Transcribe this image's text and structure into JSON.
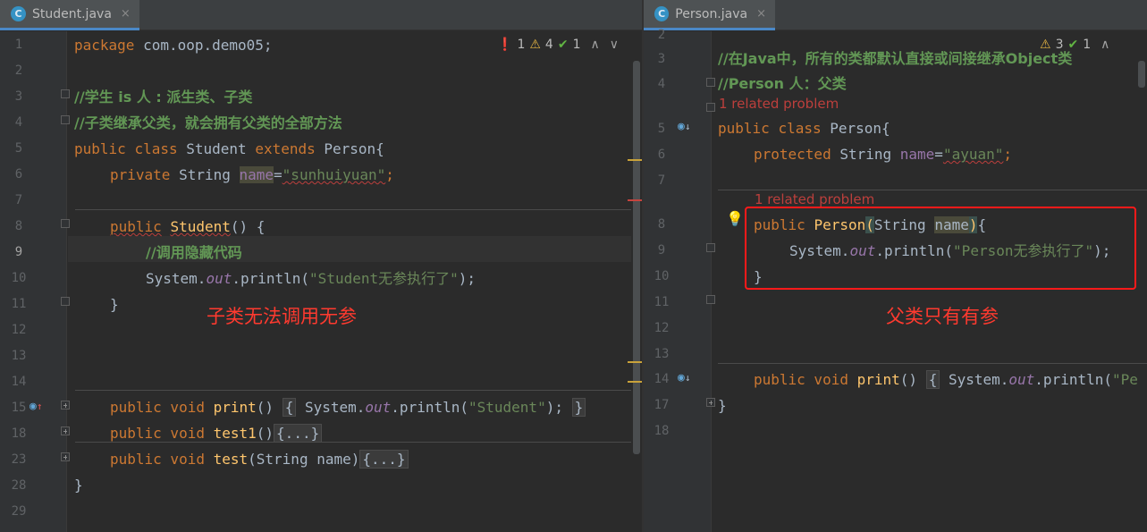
{
  "colors": {
    "editor_bg": "#2b2b2b",
    "gutter_bg": "#313335",
    "keyword": "#cc7832",
    "string": "#6a8759",
    "comment": "#629755",
    "method": "#ffc66d",
    "field": "#9876aa",
    "annotation_red": "#ff3a2f",
    "error": "#bc3f3c"
  },
  "left": {
    "tab": {
      "icon": "C",
      "label": "Student.java",
      "close": "×"
    },
    "inspections": {
      "errors": "1",
      "warnings": "4",
      "weak": "1"
    },
    "line_numbers": [
      "1",
      "2",
      "3",
      "4",
      "5",
      "6",
      "7",
      "8",
      "9",
      "10",
      "11",
      "12",
      "13",
      "14",
      "15",
      "18",
      "23",
      "28",
      "29"
    ],
    "code": {
      "l1": {
        "kw": "package",
        "rest": " com.oop.demo05;"
      },
      "l3": "//学生 is 人 : 派生类、子类",
      "l4": "//子类继承父类，就会拥有父类的全部方法",
      "l5": {
        "kw1": "public",
        "kw2": "class",
        "cls": " Student ",
        "kw3": "extends",
        "rest": " Person{"
      },
      "l6": {
        "kw": "private",
        "type": " String ",
        "name": "name",
        "eq": "=",
        "val": "\"sunhuiyuan\"",
        "semi": ";"
      },
      "l8": {
        "kw": "public",
        "ctor": "Student",
        "rest": "() {"
      },
      "l9": "//调用隐藏代码",
      "l10": {
        "pre": "System.",
        "out": "out",
        "mid": ".println(",
        "str": "\"Student无参执行了\"",
        "end": ");"
      },
      "l11": "}",
      "l15": {
        "kw": "public void",
        "fn": "print",
        "paren": "()",
        "ob": "{",
        "pre": " System.",
        "out": "out",
        "mid": ".println(",
        "str": "\"Student\"",
        "end": ");",
        "cb": "}"
      },
      "l18": {
        "kw": "public void",
        "fn": "test1",
        "paren": "()",
        "fold": "{...}"
      },
      "l23": {
        "kw": "public void",
        "fn": "test",
        "paren": "(String name)",
        "fold": "{...}"
      },
      "l28": "}"
    },
    "annotation": "子类无法调用无参"
  },
  "right": {
    "tab": {
      "icon": "C",
      "label": "Person.java",
      "close": "×"
    },
    "inspections": {
      "warnings": "3",
      "weak": "1"
    },
    "line_numbers": [
      "2",
      "3",
      "4",
      "5",
      "6",
      "7",
      "8",
      "9",
      "10",
      "11",
      "12",
      "13",
      "14",
      "17",
      "18"
    ],
    "code": {
      "l3": "//在Java中，所有的类都默认直接或间接继承Object类",
      "l4": "//Person 人：父类",
      "related1": "1 related problem",
      "l5": {
        "kw1": "public",
        "kw2": "class",
        "rest": " Person{"
      },
      "l6": {
        "kw": "protected",
        "type": " String ",
        "name": "name",
        "eq": "=",
        "val": "\"ayuan\"",
        "semi": ";"
      },
      "related2": "1 related problem",
      "l8": {
        "kw": "public",
        "ctor": "Person",
        "po": "(",
        "type": "String ",
        "name": "name",
        "pc": ")",
        "ob": "{"
      },
      "l9": {
        "pre": "System.",
        "out": "out",
        "mid": ".println(",
        "str": "\"Person无参执行了\"",
        "end": ");"
      },
      "l10": "}",
      "l14": {
        "kw": "public void",
        "fn": "print",
        "paren": "()",
        "ob": "{",
        "pre": " System.",
        "out": "out",
        "mid": ".println(",
        "str": "\"Pe"
      },
      "l17": "}"
    },
    "annotation": "父类只有有参"
  }
}
